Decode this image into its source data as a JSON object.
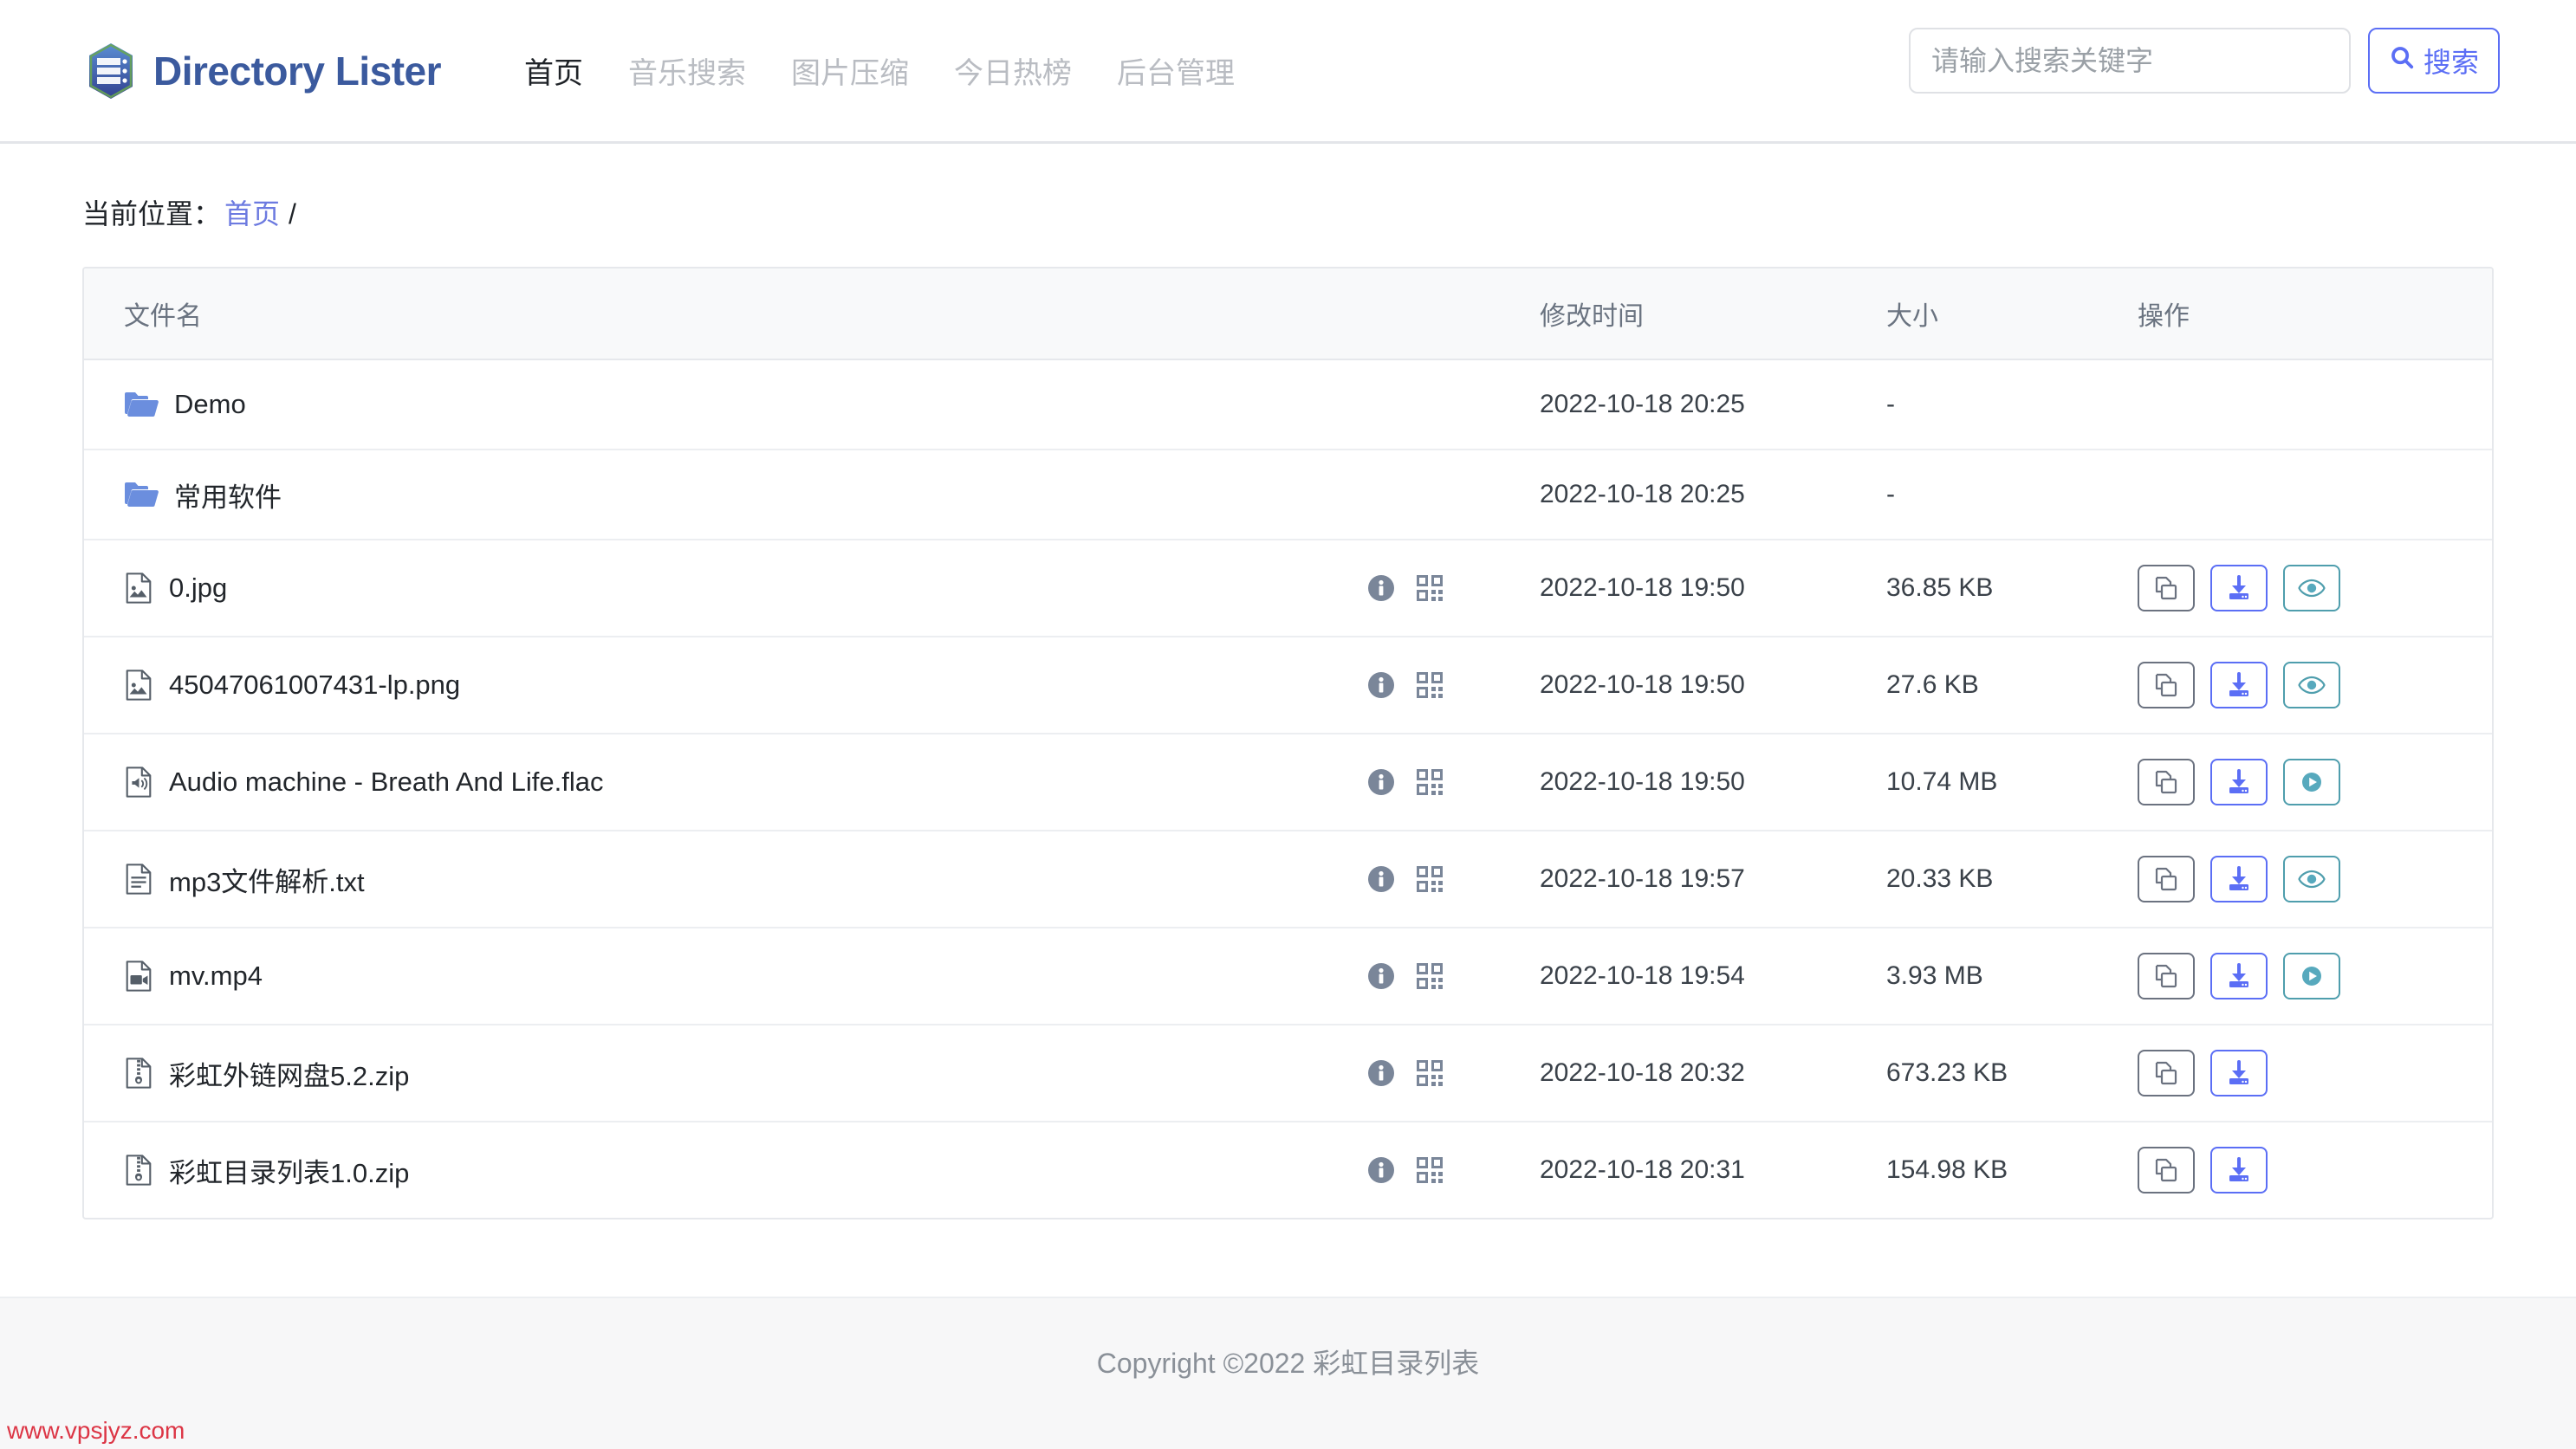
{
  "header": {
    "brand": {
      "name": "Directory Lister",
      "logo_icon": "directory-lister-logo"
    },
    "nav": [
      {
        "label": "首页",
        "active": true
      },
      {
        "label": "音乐搜索",
        "active": false
      },
      {
        "label": "图片压缩",
        "active": false
      },
      {
        "label": "今日热榜",
        "active": false
      },
      {
        "label": "后台管理",
        "active": false
      }
    ],
    "search": {
      "placeholder": "请输入搜索关键字",
      "value": "",
      "button_label": "搜索",
      "button_icon": "search-icon"
    }
  },
  "breadcrumb": {
    "label": "当前位置：",
    "home": "首页",
    "separator": "/"
  },
  "table": {
    "columns": [
      "文件名",
      "修改时间",
      "大小",
      "操作"
    ],
    "rows": [
      {
        "name": "Demo",
        "type": "folder",
        "icon": "folder-icon",
        "has_badges": false,
        "time": "2022-10-18 20:25",
        "size": "-",
        "ops": []
      },
      {
        "name": "常用软件",
        "type": "folder",
        "icon": "folder-icon",
        "has_badges": false,
        "time": "2022-10-18 20:25",
        "size": "-",
        "ops": []
      },
      {
        "name": "0.jpg",
        "type": "image",
        "icon": "file-image-icon",
        "has_badges": true,
        "time": "2022-10-18 19:50",
        "size": "36.85 KB",
        "ops": [
          "copy",
          "download",
          "view"
        ]
      },
      {
        "name": "45047061007431-lp.png",
        "type": "image",
        "icon": "file-image-icon",
        "has_badges": true,
        "time": "2022-10-18 19:50",
        "size": "27.6 KB",
        "ops": [
          "copy",
          "download",
          "view"
        ]
      },
      {
        "name": "Audio machine - Breath And Life.flac",
        "type": "audio",
        "icon": "file-audio-icon",
        "has_badges": true,
        "time": "2022-10-18 19:50",
        "size": "10.74 MB",
        "ops": [
          "copy",
          "download",
          "play"
        ]
      },
      {
        "name": "mp3文件解析.txt",
        "type": "text",
        "icon": "file-text-icon",
        "has_badges": true,
        "time": "2022-10-18 19:57",
        "size": "20.33 KB",
        "ops": [
          "copy",
          "download",
          "view"
        ]
      },
      {
        "name": "mv.mp4",
        "type": "video",
        "icon": "file-video-icon",
        "has_badges": true,
        "time": "2022-10-18 19:54",
        "size": "3.93 MB",
        "ops": [
          "copy",
          "download",
          "play"
        ]
      },
      {
        "name": "彩虹外链网盘5.2.zip",
        "type": "archive",
        "icon": "file-archive-icon",
        "has_badges": true,
        "time": "2022-10-18 20:32",
        "size": "673.23 KB",
        "ops": [
          "copy",
          "download"
        ]
      },
      {
        "name": "彩虹目录列表1.0.zip",
        "type": "archive",
        "icon": "file-archive-icon",
        "has_badges": true,
        "time": "2022-10-18 20:31",
        "size": "154.98 KB",
        "ops": [
          "copy",
          "download"
        ]
      }
    ],
    "badge_icons": [
      "info-icon",
      "qrcode-icon"
    ]
  },
  "footer": {
    "copyright": "Copyright ©2022 彩虹目录列表"
  },
  "watermark": {
    "text": "www.vpsjyz.com"
  },
  "colors": {
    "brand": "#3b5a9e",
    "accent_blue": "#5b6ef5",
    "link": "#6c7ae0",
    "teal": "#4f9ead",
    "folder": "#6b8ede",
    "watermark_red": "#dc3545"
  }
}
